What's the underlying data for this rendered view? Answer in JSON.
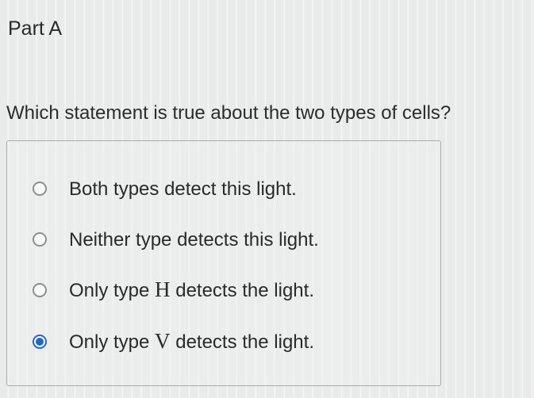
{
  "header": {
    "part_title": "Part A"
  },
  "question": {
    "text": "Which statement is true about the two types of cells?"
  },
  "options": [
    {
      "before": "Both types detect this light.",
      "var": "",
      "after": "",
      "selected": false
    },
    {
      "before": "Neither type detects this light.",
      "var": "",
      "after": "",
      "selected": false
    },
    {
      "before": "Only type ",
      "var": "H",
      "after": " detects the light.",
      "selected": false
    },
    {
      "before": "Only type ",
      "var": "V",
      "after": " detects the light.",
      "selected": true
    }
  ],
  "colors": {
    "selected_radio": "#1e66d6",
    "unselected_radio_border": "#8b8f91"
  }
}
